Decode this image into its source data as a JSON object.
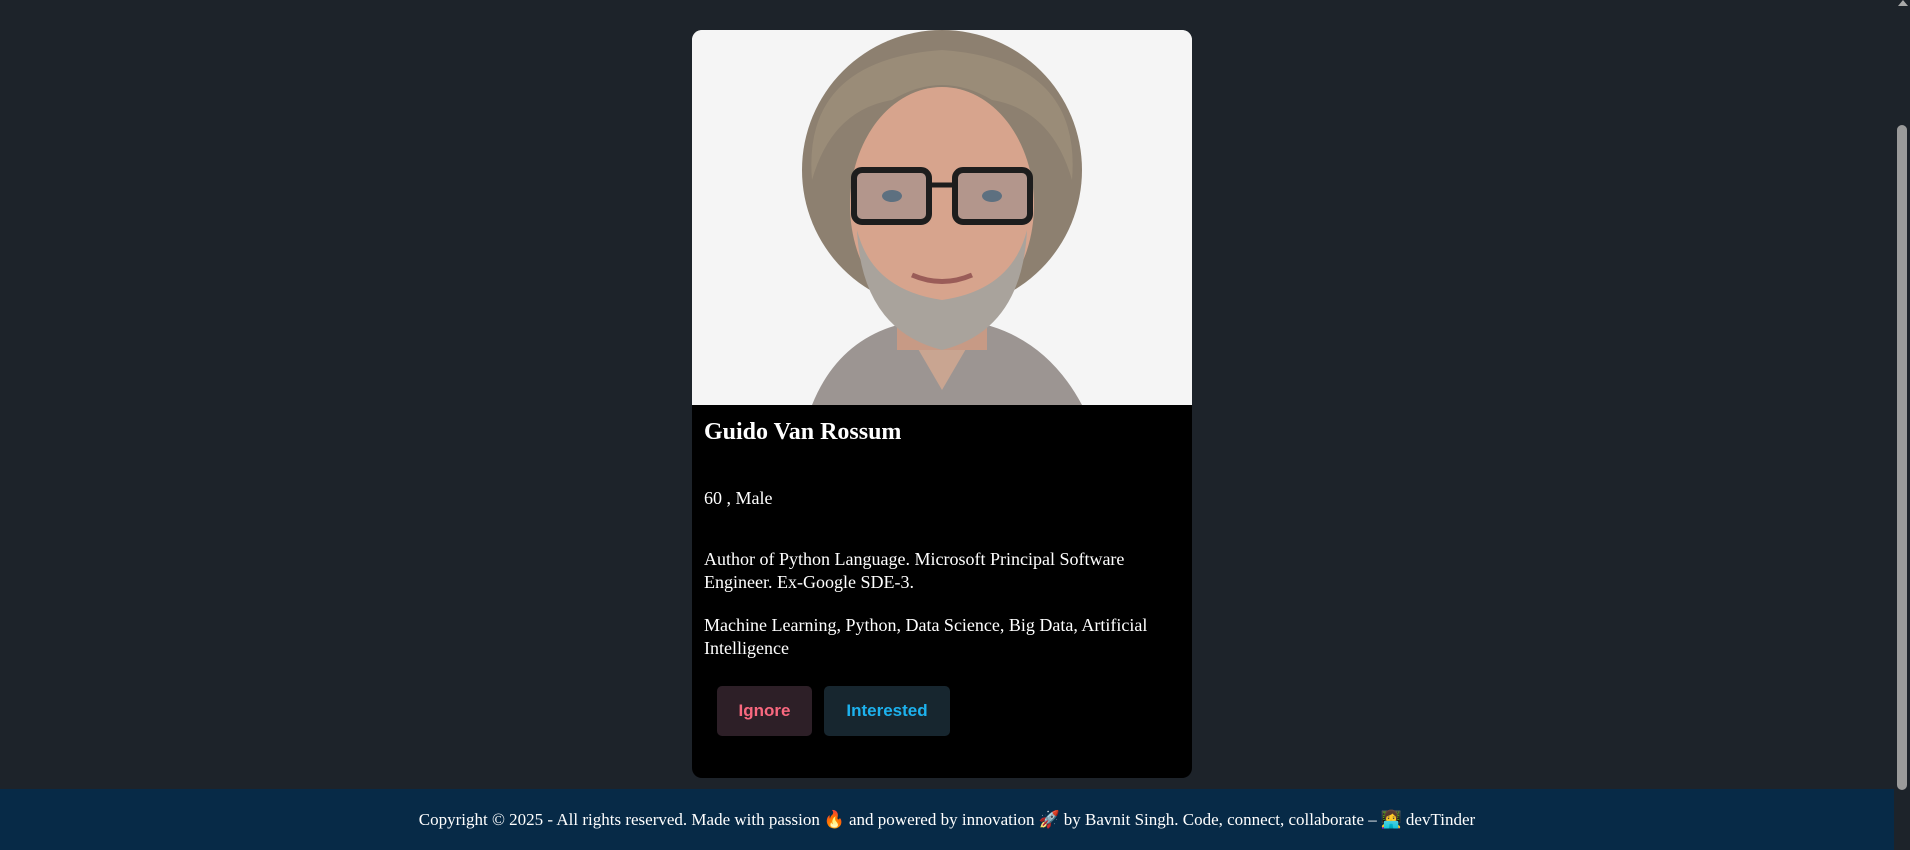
{
  "card": {
    "photo_alt": "Guido Van Rossum",
    "name": "Guido Van Rossum",
    "age_gender": "60 , Male",
    "about": "Author of Python Language. Microsoft Principal Software Engineer. Ex-Google SDE-3.",
    "skills": "Machine Learning, Python, Data Science, Big Data, Artificial Intelligence"
  },
  "actions": {
    "ignore_label": "Ignore",
    "interested_label": "Interested"
  },
  "footer": {
    "text_part1": "Copyright © 2025 - All rights reserved. Made with passion",
    "fire_emoji": "🔥",
    "text_part2": "and powered by innovation",
    "rocket_emoji": "🚀",
    "text_part3": "by Bavnit Singh. Code, connect, collaborate –",
    "coder_emoji": "👩‍💻",
    "text_part4": "devTinder"
  },
  "colors": {
    "background": "#1d232a",
    "card": "#000000",
    "ignore": "#f9687f",
    "interested": "#1db2ee",
    "footer": "#072a47"
  }
}
